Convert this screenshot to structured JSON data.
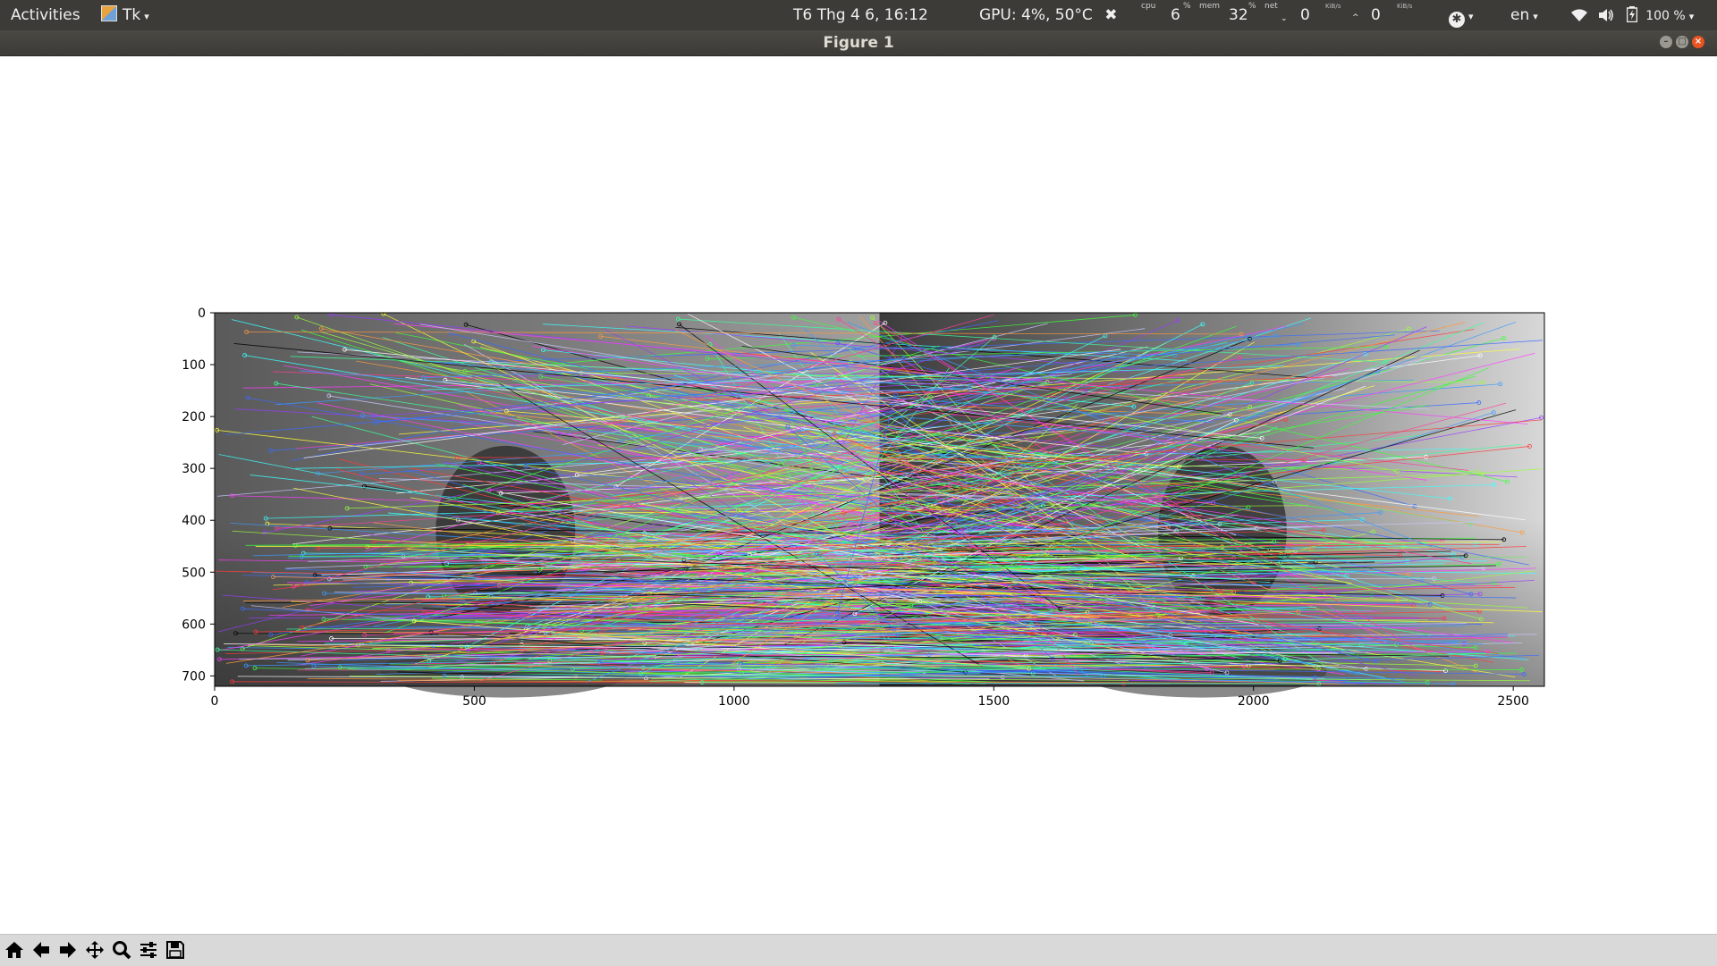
{
  "topbar": {
    "activities": "Activities",
    "app_menu": "Tk",
    "datetime": "T6 Thg 4  6, 16:12",
    "gpu": "GPU: 4%, 50°C",
    "cpu_label": "cpu",
    "cpu_value": "6",
    "mem_label": "mem",
    "mem_value": "32",
    "percent_sign": "%",
    "net_label": "net",
    "net_down": "0",
    "net_up": "0",
    "net_unit": "KiB/s",
    "language": "en",
    "battery": "100 %"
  },
  "window": {
    "title": "Figure 1"
  },
  "colors": {
    "panel_bg": "#3c3b37",
    "close_button": "#e95420",
    "toolbar_bg": "#d9d9d9"
  },
  "toolbar": {
    "icons": [
      "home-icon",
      "back-arrow-icon",
      "forward-arrow-icon",
      "pan-icon",
      "zoom-icon",
      "configure-subplots-icon",
      "save-icon"
    ]
  },
  "chart_data": {
    "type": "image",
    "title": "",
    "xlabel": "",
    "ylabel": "",
    "xlim": [
      0,
      2560
    ],
    "ylim": [
      720,
      0
    ],
    "xticks": [
      0,
      500,
      1000,
      1500,
      2000,
      2500
    ],
    "yticks": [
      0,
      100,
      200,
      300,
      400,
      500,
      600,
      700
    ],
    "image_split_x": 1280,
    "content": "side-by-side grayscale image pair with many colored feature-match lines"
  }
}
